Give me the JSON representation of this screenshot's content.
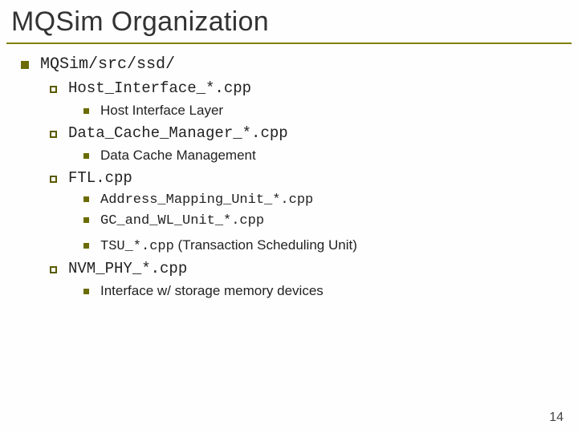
{
  "title": "MQSim Organization",
  "page_number": "14",
  "lvl1": {
    "text": "MQSim/src/ssd/"
  },
  "lvl2": {
    "host_if": "Host_Interface_*.cpp",
    "data_cache": "Data_Cache_Manager_*.cpp",
    "ftl": "FTL.cpp",
    "nvm": "NVM_PHY_*.cpp"
  },
  "lvl3": {
    "host_if_desc": "Host Interface Layer",
    "data_cache_desc": "Data Cache Management",
    "addr_map": "Address_Mapping_Unit_*.cpp",
    "gc_wl": "GC_and_WL_Unit_*.cpp",
    "tsu_mono": "TSU_*.cpp",
    "tsu_paren": " (Transaction Scheduling Unit)",
    "nvm_desc": "Interface w/ storage memory devices"
  }
}
